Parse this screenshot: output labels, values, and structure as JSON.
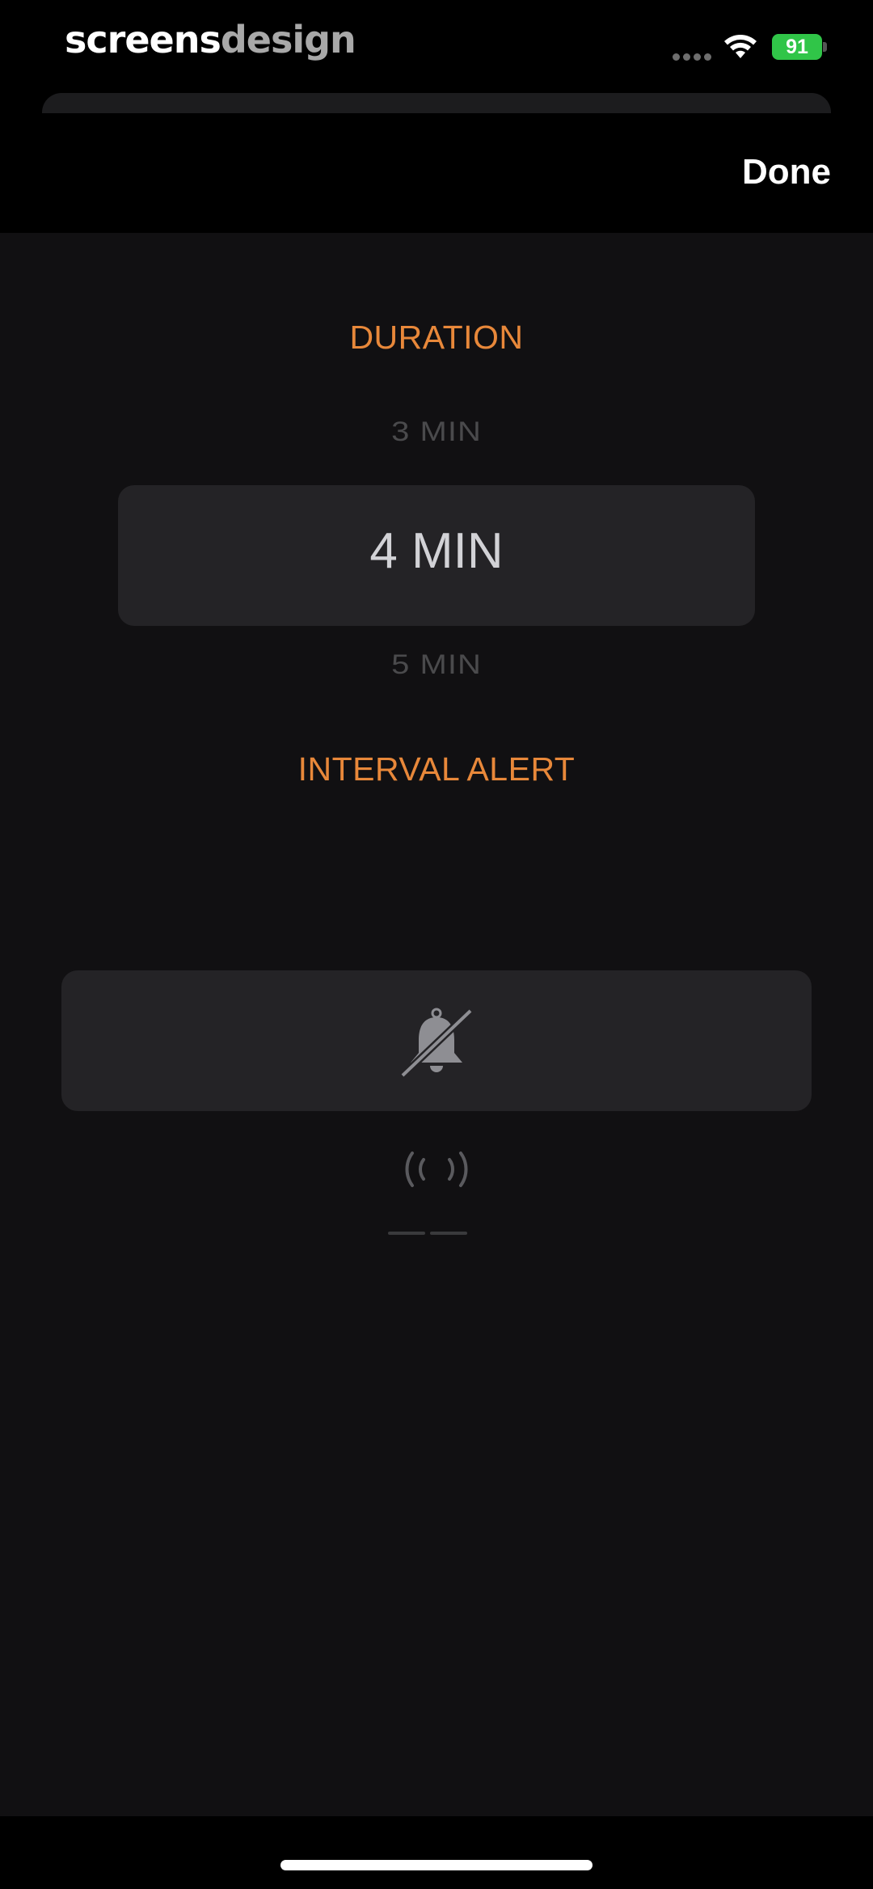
{
  "status_bar": {
    "brand_primary": "screens",
    "brand_secondary": "design",
    "battery_level": "91"
  },
  "header": {
    "done_label": "Done"
  },
  "duration": {
    "title": "DURATION",
    "options": [
      "3 MIN",
      "4 MIN",
      "5 MIN"
    ],
    "selected": "4 MIN"
  },
  "interval_alert": {
    "title": "INTERVAL ALERT",
    "options": [
      "bell-off-icon",
      "vibrate-icon",
      "faint-option"
    ],
    "selected": "bell-off-icon"
  },
  "colors": {
    "accent": "#e8883a",
    "background": "#111012",
    "selection": "#242326"
  }
}
